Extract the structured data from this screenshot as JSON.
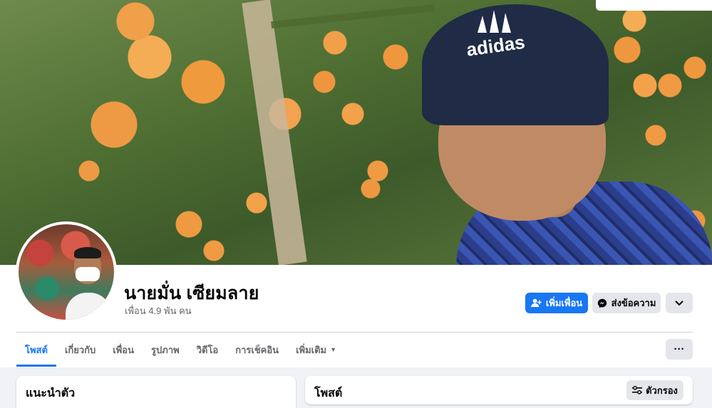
{
  "profile": {
    "name": "นายมั่น เซียมลาย",
    "friends_text": "เพื่อน 4.9 พัน คน"
  },
  "cover": {
    "cap_brand_text": "adidas"
  },
  "actions": {
    "add_friend_label": "เพิ่มเพื่อน",
    "message_label": "ส่งข้อความ",
    "more_icon": "chevron-down-icon"
  },
  "tabs": [
    {
      "label": "โพสต์",
      "active": true
    },
    {
      "label": "เกี่ยวกับ",
      "active": false
    },
    {
      "label": "เพื่อน",
      "active": false
    },
    {
      "label": "รูปภาพ",
      "active": false
    },
    {
      "label": "วิดีโอ",
      "active": false
    },
    {
      "label": "การเช็คอิน",
      "active": false
    },
    {
      "label": "เพิ่มเติม",
      "active": false
    }
  ],
  "tabs_more_label": "···",
  "intro": {
    "title": "แนะนำตัว"
  },
  "posts": {
    "title": "โพสต์",
    "filter_label": "ตัวกรอง"
  },
  "colors": {
    "accent": "#1877f2",
    "secondary_button": "#e4e6eb",
    "page_bg": "#f0f2f5"
  }
}
